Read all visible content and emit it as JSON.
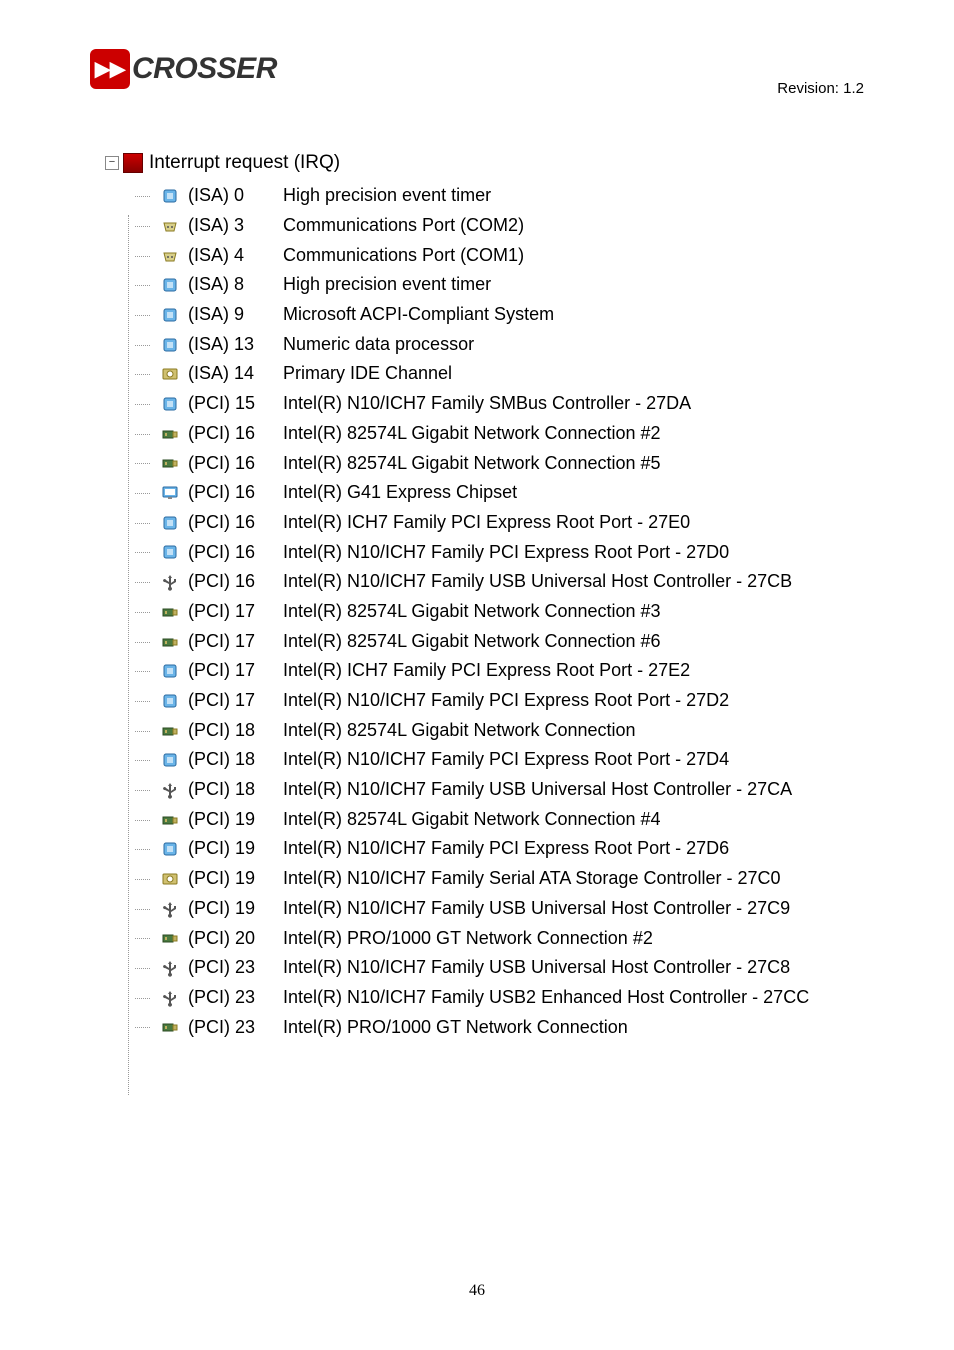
{
  "revision": "Revision: 1.2",
  "logo_text": "CROSSER",
  "root_label": "Interrupt request (IRQ)",
  "page_number": "46",
  "items": [
    {
      "icon": "chip",
      "irq": "(ISA) 0",
      "desc": "High precision event timer"
    },
    {
      "icon": "port",
      "irq": "(ISA) 3",
      "desc": "Communications Port (COM2)"
    },
    {
      "icon": "port",
      "irq": "(ISA) 4",
      "desc": "Communications Port (COM1)"
    },
    {
      "icon": "chip",
      "irq": "(ISA) 8",
      "desc": "High precision event timer"
    },
    {
      "icon": "chip",
      "irq": "(ISA) 9",
      "desc": "Microsoft ACPI-Compliant System"
    },
    {
      "icon": "chip",
      "irq": "(ISA) 13",
      "desc": "Numeric data processor"
    },
    {
      "icon": "ide",
      "irq": "(ISA) 14",
      "desc": "Primary IDE Channel"
    },
    {
      "icon": "chip",
      "irq": "(PCI) 15",
      "desc": "Intel(R) N10/ICH7 Family SMBus Controller - 27DA"
    },
    {
      "icon": "nic",
      "irq": "(PCI) 16",
      "desc": "Intel(R) 82574L Gigabit Network Connection #2"
    },
    {
      "icon": "nic",
      "irq": "(PCI) 16",
      "desc": "Intel(R) 82574L Gigabit Network Connection #5"
    },
    {
      "icon": "display",
      "irq": "(PCI) 16",
      "desc": "Intel(R) G41 Express Chipset"
    },
    {
      "icon": "chip",
      "irq": "(PCI) 16",
      "desc": "Intel(R) ICH7 Family PCI Express Root Port - 27E0"
    },
    {
      "icon": "chip",
      "irq": "(PCI) 16",
      "desc": "Intel(R) N10/ICH7 Family PCI Express Root Port - 27D0"
    },
    {
      "icon": "usb",
      "irq": "(PCI) 16",
      "desc": "Intel(R) N10/ICH7 Family USB Universal Host Controller - 27CB"
    },
    {
      "icon": "nic",
      "irq": "(PCI) 17",
      "desc": "Intel(R) 82574L Gigabit Network Connection #3"
    },
    {
      "icon": "nic",
      "irq": "(PCI) 17",
      "desc": "Intel(R) 82574L Gigabit Network Connection #6"
    },
    {
      "icon": "chip",
      "irq": "(PCI) 17",
      "desc": "Intel(R) ICH7 Family PCI Express Root Port - 27E2"
    },
    {
      "icon": "chip",
      "irq": "(PCI) 17",
      "desc": "Intel(R) N10/ICH7 Family PCI Express Root Port - 27D2"
    },
    {
      "icon": "nic",
      "irq": "(PCI) 18",
      "desc": "Intel(R) 82574L Gigabit Network Connection"
    },
    {
      "icon": "chip",
      "irq": "(PCI) 18",
      "desc": "Intel(R) N10/ICH7 Family PCI Express Root Port - 27D4"
    },
    {
      "icon": "usb",
      "irq": "(PCI) 18",
      "desc": "Intel(R) N10/ICH7 Family USB Universal Host Controller - 27CA"
    },
    {
      "icon": "nic",
      "irq": "(PCI) 19",
      "desc": "Intel(R) 82574L Gigabit Network Connection #4"
    },
    {
      "icon": "chip",
      "irq": "(PCI) 19",
      "desc": "Intel(R) N10/ICH7 Family PCI Express Root Port - 27D6"
    },
    {
      "icon": "ide",
      "irq": "(PCI) 19",
      "desc": "Intel(R) N10/ICH7 Family Serial ATA Storage Controller - 27C0"
    },
    {
      "icon": "usb",
      "irq": "(PCI) 19",
      "desc": "Intel(R) N10/ICH7 Family USB Universal Host Controller - 27C9"
    },
    {
      "icon": "nic",
      "irq": "(PCI) 20",
      "desc": "Intel(R) PRO/1000 GT Network Connection #2"
    },
    {
      "icon": "usb",
      "irq": "(PCI) 23",
      "desc": "Intel(R) N10/ICH7 Family USB Universal Host Controller - 27C8"
    },
    {
      "icon": "usb",
      "irq": "(PCI) 23",
      "desc": "Intel(R) N10/ICH7 Family USB2 Enhanced Host Controller - 27CC"
    },
    {
      "icon": "nic",
      "irq": "(PCI) 23",
      "desc": "Intel(R) PRO/1000 GT Network Connection"
    }
  ],
  "icons": {
    "chip": "🟦",
    "port": "📟",
    "ide": "💾",
    "nic": "🖧",
    "display": "🖥",
    "usb": "🔌"
  }
}
